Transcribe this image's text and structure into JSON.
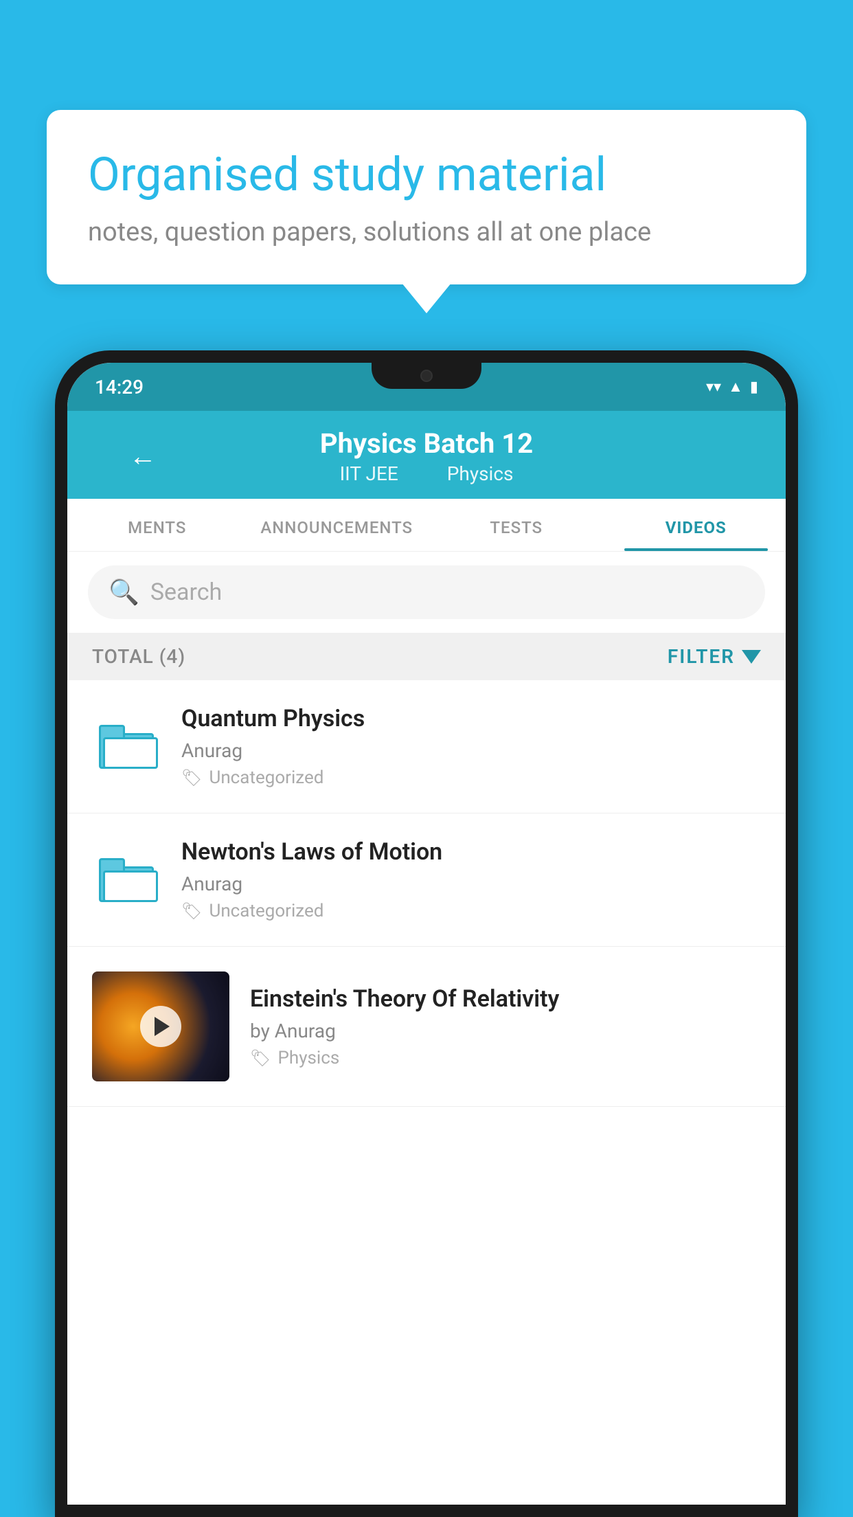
{
  "background": {
    "color": "#29b9e8"
  },
  "speech_bubble": {
    "title": "Organised study material",
    "subtitle": "notes, question papers, solutions all at one place"
  },
  "phone": {
    "status_bar": {
      "time": "14:29",
      "icons": [
        "wifi",
        "signal",
        "battery"
      ]
    },
    "header": {
      "back_label": "←",
      "title": "Physics Batch 12",
      "subtitle_part1": "IIT JEE",
      "subtitle_part2": "Physics"
    },
    "tabs": [
      {
        "label": "MENTS",
        "active": false
      },
      {
        "label": "ANNOUNCEMENTS",
        "active": false
      },
      {
        "label": "TESTS",
        "active": false
      },
      {
        "label": "VIDEOS",
        "active": true
      }
    ],
    "search": {
      "placeholder": "Search"
    },
    "filter_bar": {
      "total_label": "TOTAL (4)",
      "filter_label": "FILTER"
    },
    "videos": [
      {
        "id": 1,
        "title": "Quantum Physics",
        "author": "Anurag",
        "tag": "Uncategorized",
        "has_thumbnail": false
      },
      {
        "id": 2,
        "title": "Newton's Laws of Motion",
        "author": "Anurag",
        "tag": "Uncategorized",
        "has_thumbnail": false
      },
      {
        "id": 3,
        "title": "Einstein's Theory Of Relativity",
        "author": "by Anurag",
        "tag": "Physics",
        "has_thumbnail": true
      }
    ]
  }
}
